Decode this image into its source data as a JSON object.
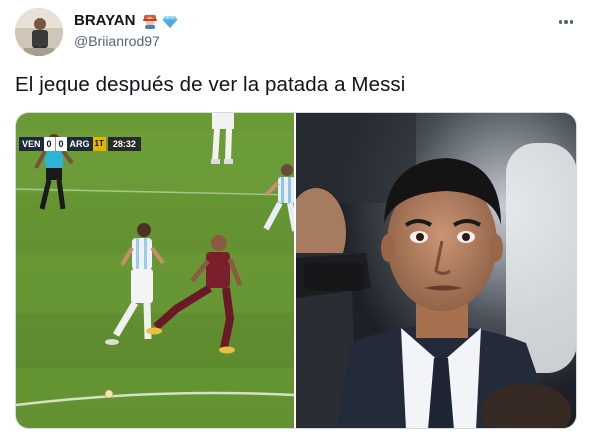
{
  "tweet": {
    "author": {
      "display_name": "BRAYAN",
      "handle": "@Briianrod97",
      "name_emojis": [
        "person-emoji",
        "gem-emoji"
      ]
    },
    "text": "El jeque después de ver la patada a Messi",
    "more_icon": "more-options-icon"
  },
  "media": {
    "left": {
      "scoreboard": {
        "home": "VEN",
        "home_score": "0",
        "away_score": "0",
        "away": "ARG",
        "half": "1T",
        "clock": "28:32"
      }
    }
  },
  "colors": {
    "text_primary": "#0f1419",
    "text_secondary": "#536471",
    "border": "#cfd9de",
    "pitch": "#5c8a2f"
  }
}
